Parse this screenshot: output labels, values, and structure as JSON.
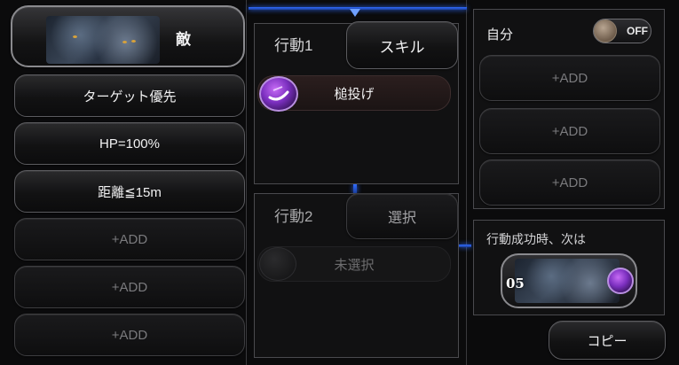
{
  "left": {
    "enemy_label": "敵",
    "conditions": [
      "ターゲット優先",
      "HP=100%",
      "距離≦15m"
    ],
    "add_slots": [
      "+ADD",
      "+ADD",
      "+ADD"
    ]
  },
  "action1": {
    "title": "行動1",
    "type_button": "スキル",
    "skill_name": "槌投げ",
    "skill_icon": "hammer-throw-icon"
  },
  "action2": {
    "title": "行動2",
    "type_button": "選択",
    "skill_name": "未選択"
  },
  "self": {
    "label": "自分",
    "toggle_text": "OFF",
    "add_slots": [
      "+ADD",
      "+ADD",
      "+ADD"
    ]
  },
  "next": {
    "label": "行動成功時、次は",
    "number": "05"
  },
  "copy_button": "コピー",
  "colors": {
    "accent_blue": "#2f6bff",
    "skill_purple": "#7b2fbf",
    "toggle_knob": "#b8a591"
  }
}
